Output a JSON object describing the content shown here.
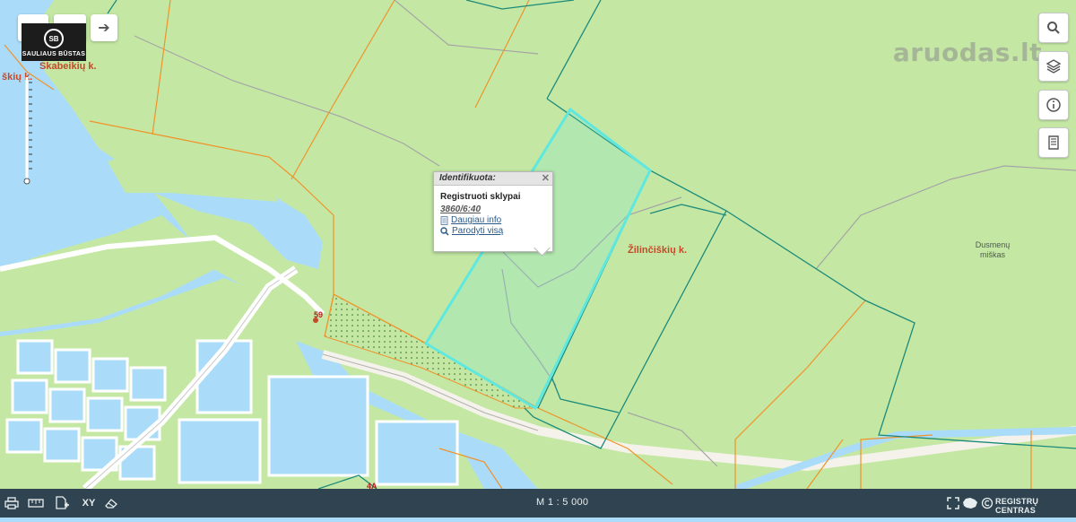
{
  "map": {
    "place_labels": [
      "Skabeikių k.",
      "Žilinčiškių k."
    ],
    "partial_label": "škių k.",
    "forest_label": [
      "Dusmenų",
      "miškas"
    ],
    "road_numbers": [
      "59",
      "4A"
    ]
  },
  "watermark": "aruodas.lt",
  "logo": {
    "emblem": "SB",
    "brand": "SAULIAUS BŪSTAS"
  },
  "popup": {
    "header": "Identifikuota:",
    "close": "✕",
    "layer_title": "Registruoti sklypai",
    "parcel_id": "3860/6:40",
    "link_info": "Daugiau info",
    "link_show_all": "Parodyti visą"
  },
  "bottom_bar": {
    "scale": "M 1 : 5 000",
    "xy_label": "XY",
    "registry_label": "REGISTRŲ CENTRAS"
  },
  "icons": {
    "share": "arrow-right-icon",
    "search": "search-icon",
    "layers": "layers-icon",
    "info": "info-icon",
    "legend": "document-icon"
  },
  "colors": {
    "land": "#c4e8a4",
    "water": "#aadcf9",
    "selected_parcel": "#66e8e4",
    "parcel_border": "#1c8a7a",
    "boundary": "#f0922a",
    "bar": "#2f4450"
  }
}
